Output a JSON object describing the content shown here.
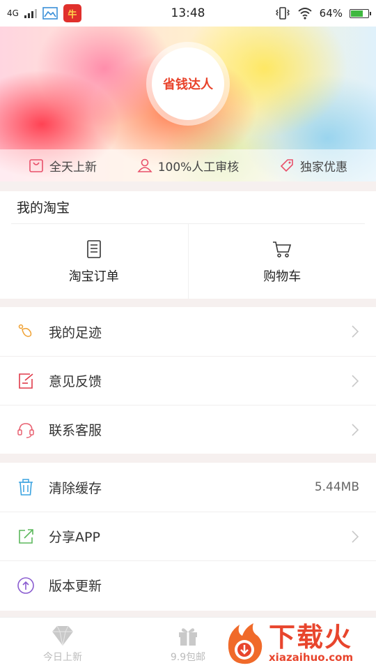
{
  "status_bar": {
    "network": "4G",
    "app_badge_text": "牛",
    "time": "13:48",
    "battery": "64%",
    "battery_level": 0.64
  },
  "hero": {
    "avatar_text": "省钱达人",
    "perks": [
      {
        "label": "全天上新",
        "icon": "shopping-bag-icon"
      },
      {
        "label": "100%人工审核",
        "icon": "person-icon"
      },
      {
        "label": "独家优惠",
        "icon": "tag-icon"
      }
    ]
  },
  "taobao": {
    "title": "我的淘宝",
    "items": [
      {
        "label": "淘宝订单",
        "icon": "order-list-icon"
      },
      {
        "label": "购物车",
        "icon": "cart-icon"
      }
    ]
  },
  "menu_group_1": [
    {
      "label": "我的足迹",
      "icon": "footprint-icon",
      "color": "#f0a030"
    },
    {
      "label": "意见反馈",
      "icon": "feedback-icon",
      "color": "#e03a4a"
    },
    {
      "label": "联系客服",
      "icon": "headset-icon",
      "color": "#e86070"
    }
  ],
  "menu_group_2": [
    {
      "label": "清除缓存",
      "icon": "trash-icon",
      "value": "5.44MB",
      "color": "#3aa3e0"
    },
    {
      "label": "分享APP",
      "icon": "share-icon",
      "color": "#5cb85c"
    },
    {
      "label": "版本更新",
      "icon": "upload-icon",
      "color": "#8a5cd0"
    }
  ],
  "tabbar": [
    {
      "label": "今日上新",
      "icon": "diamond-icon"
    },
    {
      "label": "9.9包邮",
      "icon": "gift-icon"
    }
  ],
  "watermark": {
    "brand": "下载火",
    "url": "xiazaihuo.com"
  }
}
